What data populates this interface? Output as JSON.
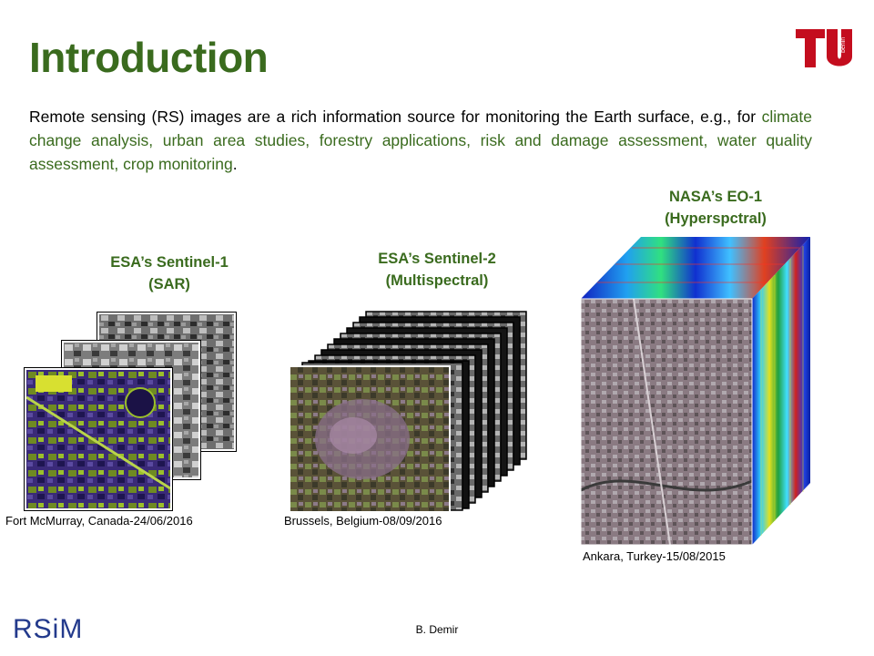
{
  "slide": {
    "title": "Introduction",
    "intro_plain": "Remote sensing (RS) images are a rich information source for monitoring the Earth surface, e.g., for ",
    "intro_highlight": "climate change analysis, urban area studies, forestry applications, risk and damage assessment, water quality assessment, crop monitoring",
    "intro_end": "."
  },
  "figures": {
    "sentinel1": {
      "caption_line1": "ESA’s Sentinel-1",
      "caption_line2": "(SAR)",
      "location": "Fort McMurray, Canada-24/06/2016"
    },
    "sentinel2": {
      "caption_line1": "ESA’s Sentinel-2",
      "caption_line2": "(Multispectral)",
      "location": "Brussels, Belgium-08/09/2016"
    },
    "eo1": {
      "caption_line1": "NASA’s EO-1",
      "caption_line2": "(Hyperspctral)",
      "location": "Ankara, Turkey-15/08/2015"
    }
  },
  "footer": {
    "author": "B. Demir",
    "logo_text": "RSiM"
  },
  "colors": {
    "title_green": "#3a6b1e",
    "tu_red": "#c40d1e",
    "rsim_blue": "#233a8c"
  }
}
